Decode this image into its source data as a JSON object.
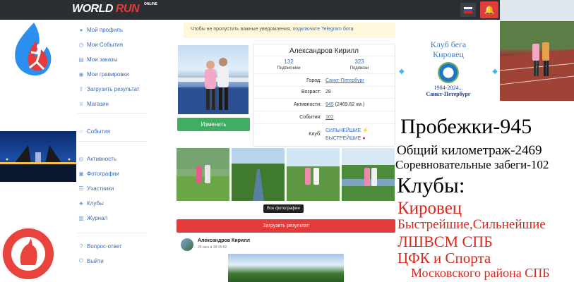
{
  "header": {
    "logo_world": "WORLD",
    "logo_run": "RUN",
    "logo_online": "ONLINE",
    "icons": [
      "flag-icon",
      "bell-icon"
    ]
  },
  "sidebar": {
    "items": [
      {
        "label": "Мой профиль",
        "icon": "profile-icon"
      },
      {
        "label": "Мои События",
        "icon": "events-icon"
      },
      {
        "label": "Мои заказы",
        "icon": "orders-icon"
      },
      {
        "label": "Мои гравировки",
        "icon": "engraving-icon"
      },
      {
        "label": "Загрузить результат",
        "icon": "upload-icon"
      },
      {
        "label": "Магазин",
        "icon": "shop-icon"
      },
      {
        "label": "События",
        "icon": "star-icon"
      },
      {
        "label": "Активность",
        "icon": "activity-icon"
      },
      {
        "label": "Фотографии",
        "icon": "photo-icon"
      },
      {
        "label": "Участники",
        "icon": "users-icon"
      },
      {
        "label": "Клубы",
        "icon": "clubs-icon"
      },
      {
        "label": "Журнал",
        "icon": "journal-icon"
      },
      {
        "label": "Вопрос-ответ",
        "icon": "question-icon"
      },
      {
        "label": "Выйти",
        "icon": "logout-icon"
      }
    ]
  },
  "notice": {
    "text": "Чтобы не пропустить важные уведомления, ",
    "link": "подключите Telegram бота"
  },
  "profile": {
    "name": "Александров Кирилл",
    "edit_label": "Изменить",
    "followers_count": "132",
    "followers_label": "Подписчики",
    "following_count": "323",
    "following_label": "Подписки",
    "city_label": "Город:",
    "city_value": "Санкт-Петербург",
    "age_label": "Возраст:",
    "age_value": "28",
    "activity_label": "Активности:",
    "activity_link": "945",
    "activity_km": "(2469.62 км.)",
    "events_label": "События:",
    "events_value": "102",
    "club_label": "Клуб:",
    "club_1": "СИЛЬНЕЙШИЕ",
    "club_2": "БЫСТРЕЙШИЕ"
  },
  "photos": {
    "tooltip": "Все фотографии"
  },
  "upload_label": "Загрузить результат",
  "post": {
    "author": "Александров Кирилл",
    "date": "25 июн в 18:15:52"
  },
  "club_badge": {
    "title_line1": "Клуб бега",
    "title_line2": "Кировец",
    "years": "1984-2024...",
    "city": "Санкт-Петербург"
  },
  "overlay": {
    "runs": "Пробежки-945",
    "total_km": "Общий километраж-2469",
    "races": "Соревновательные забеги-102",
    "clubs_heading": "Клубы:",
    "club1": "Кировец",
    "club2": "Быстрейшие,Сильнейшие",
    "club3": "ЛШВСМ СПБ",
    "club4": "ЦФК и Спорта",
    "club5": "Московского района СПБ"
  },
  "colors": {
    "topbar": "#2b2e33",
    "accent_red": "#e23b3b",
    "green": "#3fae63",
    "link_blue": "#3a6bb5",
    "overlay_red": "#d6291f"
  }
}
